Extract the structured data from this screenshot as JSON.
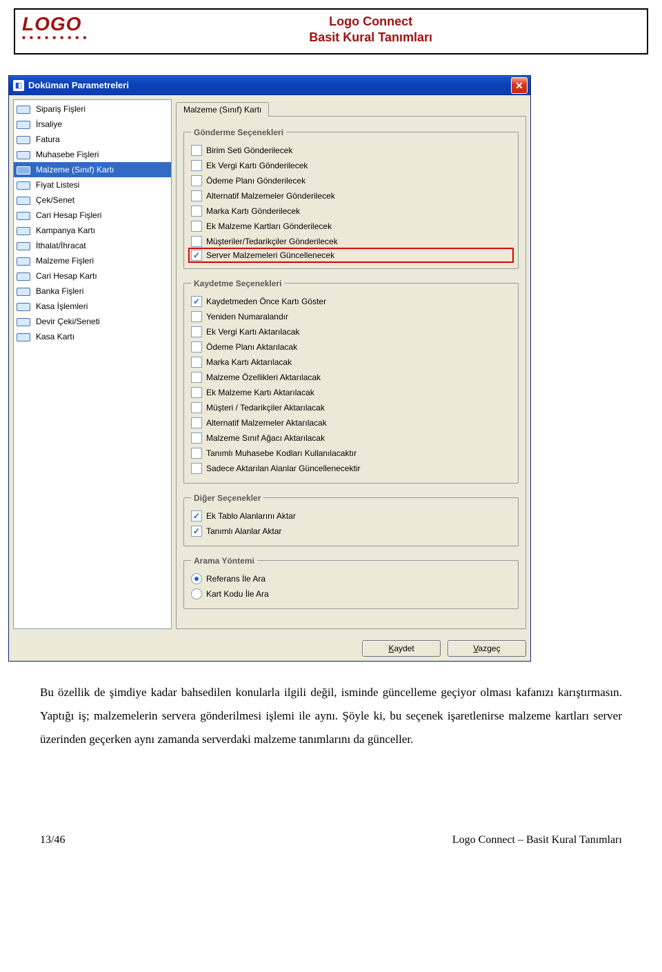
{
  "header": {
    "logo_main": "LOGO",
    "title_line1": "Logo Connect",
    "title_line2": "Basit Kural Tanımları"
  },
  "window": {
    "title": "Doküman Parametreleri",
    "sidebar": [
      "Sipariş Fişleri",
      "İrsaliye",
      "Fatura",
      "Muhasebe Fişleri",
      "Malzeme (Sınıf) Kartı",
      "Fiyat Listesi",
      "Çek/Senet",
      "Cari Hesap Fişleri",
      "Kampanya Kartı",
      "İthalat/İhracat",
      "Malzeme Fişleri",
      "Cari Hesap Kartı",
      "Banka Fişleri",
      "Kasa İşlemleri",
      "Devir Çeki/Seneti",
      "Kasa Kartı"
    ],
    "sidebar_selected_index": 4,
    "tab": "Malzeme (Sınıf) Kartı",
    "groups": {
      "gonderme": {
        "legend": "Gönderme Seçenekleri",
        "items": [
          {
            "label": "Birim Seti Gönderilecek",
            "checked": false
          },
          {
            "label": "Ek Vergi Kartı Gönderilecek",
            "checked": false
          },
          {
            "label": "Ödeme Planı Gönderilecek",
            "checked": false
          },
          {
            "label": "Alternatif Malzemeler Gönderilecek",
            "checked": false
          },
          {
            "label": "Marka Kartı Gönderilecek",
            "checked": false
          },
          {
            "label": "Ek Malzeme Kartları Gönderilecek",
            "checked": false
          },
          {
            "label": "Müşteriler/Tedarikçiler Gönderilecek",
            "checked": false
          },
          {
            "label": "Server Malzemeleri Güncellenecek",
            "checked": true,
            "highlight": true
          }
        ]
      },
      "kaydetme": {
        "legend": "Kaydetme Seçenekleri",
        "items": [
          {
            "label": "Kaydetmeden Önce Kartı Göster",
            "checked": true
          },
          {
            "label": "Yeniden Numaralandır",
            "checked": false
          },
          {
            "label": "Ek Vergi Kartı Aktarılacak",
            "checked": false
          },
          {
            "label": "Ödeme Planı Aktarılacak",
            "checked": false
          },
          {
            "label": "Marka Kartı Aktarılacak",
            "checked": false
          },
          {
            "label": "Malzeme Özellikleri Aktarılacak",
            "checked": false
          },
          {
            "label": "Ek Malzeme Kartı Aktarılacak",
            "checked": false
          },
          {
            "label": "Müşteri / Tedarikçiler Aktarılacak",
            "checked": false
          },
          {
            "label": "Alternatif Malzemeler Aktarılacak",
            "checked": false
          },
          {
            "label": "Malzeme Sınıf Ağacı Aktarılacak",
            "checked": false
          },
          {
            "label": "Tanımlı Muhasebe Kodları Kullanılacaktır",
            "checked": false
          },
          {
            "label": "Sadece Aktarılan Alanlar Güncellenecektir",
            "checked": false
          }
        ]
      },
      "diger": {
        "legend": "Diğer Seçenekler",
        "items": [
          {
            "label": "Ek Tablo Alanlarını Aktar",
            "checked": true
          },
          {
            "label": "Tanımlı Alanlar Aktar",
            "checked": true
          }
        ]
      },
      "arama": {
        "legend": "Arama Yöntemi",
        "items": [
          {
            "label": "Referans İle Ara",
            "checked": true
          },
          {
            "label": "Kart Kodu İle Ara",
            "checked": false
          }
        ]
      }
    },
    "buttons": {
      "save": "Kaydet",
      "cancel": "Vazgeç"
    }
  },
  "paragraph": "Bu özellik de şimdiye kadar bahsedilen konularla ilgili değil, isminde güncelleme geçiyor olması kafanızı karıştırmasın. Yaptığı iş; malzemelerin servera gönderilmesi işlemi ile aynı. Şöyle ki, bu seçenek işaretlenirse malzeme kartları server üzerinden geçerken aynı zamanda  serverdaki malzeme tanımlarını da günceller.",
  "footer": {
    "left": "13/46",
    "right": "Logo Connect – Basit Kural Tanımları"
  }
}
